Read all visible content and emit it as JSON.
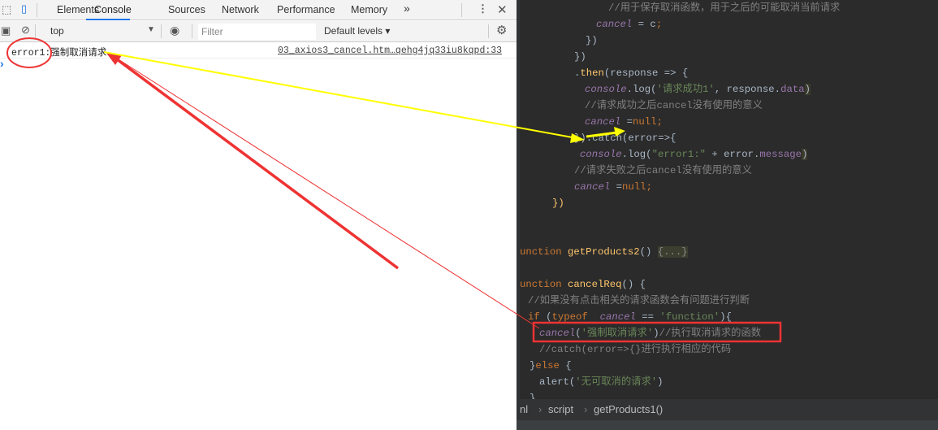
{
  "devtools": {
    "tabs": [
      "Elements",
      "Console",
      "Sources",
      "Network",
      "Performance",
      "Memory"
    ],
    "active_tab": "Console",
    "more_tabs": "»",
    "context": "top",
    "filter_placeholder": "Filter",
    "levels": "Default levels ▾",
    "console_message": {
      "text": "error1:强制取消请求",
      "source": "03_axios3_cancel.htm…qehg4jq33iu8kqpd:33"
    },
    "prompt": "›"
  },
  "editor": {
    "lines": [
      [
        [
          "//用于保存取消函数，用于之后的可能取消当前请求",
          "cm"
        ]
      ],
      [
        [
          "cancel",
          "it"
        ],
        [
          " = c",
          ""
        ],
        [
          ";",
          "kw"
        ]
      ],
      [
        [
          "})",
          ""
        ]
      ],
      [
        [
          "})",
          ""
        ]
      ],
      [
        [
          ".",
          ""
        ],
        [
          "then",
          "fn"
        ],
        [
          "(response => {",
          ""
        ]
      ],
      [
        [
          "console",
          "it"
        ],
        [
          ".log(",
          ""
        ],
        [
          "'请求成功1'",
          "str"
        ],
        [
          ", response.",
          ""
        ],
        [
          "data",
          "pr"
        ],
        [
          ")",
          "hl"
        ]
      ],
      [
        [
          "//请求成功之后cancel没有使用的意义",
          "cm"
        ]
      ],
      [
        [
          "cancel",
          "it"
        ],
        [
          " =",
          ""
        ],
        [
          "null;",
          "kw"
        ]
      ],
      [
        [
          "}).catch(error=>{",
          ""
        ]
      ],
      [
        [
          "console",
          "it"
        ],
        [
          ".log(",
          ""
        ],
        [
          "\"error1:\"",
          "str"
        ],
        [
          " + error.",
          ""
        ],
        [
          "message",
          "pr"
        ],
        [
          ")",
          "hl"
        ]
      ],
      [
        [
          "//请求失败之后cancel没有使用的意义",
          "cm"
        ]
      ],
      [
        [
          "cancel",
          "it"
        ],
        [
          " =",
          ""
        ],
        [
          "null;",
          "kw"
        ]
      ],
      [
        [
          "})",
          "fn"
        ]
      ],
      [
        [
          "unction ",
          "kw"
        ],
        [
          "getProducts2",
          "fn"
        ],
        [
          "() ",
          ""
        ],
        [
          "{...}",
          "fold"
        ]
      ],
      [
        [
          "unction ",
          "kw"
        ],
        [
          "cancelReq",
          "fn"
        ],
        [
          "() {",
          ""
        ]
      ],
      [
        [
          "//如果没有点击相关的请求函数会有问题进行判断",
          "cm"
        ]
      ],
      [
        [
          "if ",
          "kw"
        ],
        [
          "(",
          ""
        ],
        [
          "typeof  ",
          "kw"
        ],
        [
          "cancel",
          "it"
        ],
        [
          " == ",
          ""
        ],
        [
          "'function'",
          "str"
        ],
        [
          "){",
          ""
        ]
      ],
      [
        [
          "cancel",
          "it"
        ],
        [
          "(",
          ""
        ],
        [
          "'强制取消请求'",
          "str"
        ],
        [
          ")",
          ""
        ],
        [
          "//执行取消请求的函数",
          "cm"
        ]
      ],
      [
        [
          "//catch(error=>{}进行执行相应的代码",
          "cm"
        ]
      ],
      [
        [
          "}",
          ""
        ],
        [
          "else ",
          "kw"
        ],
        [
          "{",
          ""
        ]
      ],
      [
        [
          "alert(",
          ""
        ],
        [
          "'无可取消的请求'",
          "str"
        ],
        [
          ")",
          ""
        ]
      ],
      [
        [
          "}",
          ""
        ]
      ]
    ],
    "breadcrumb": [
      "nl",
      "script",
      "getProducts1()"
    ]
  },
  "annotations": {
    "arrow_color_yellow": "#ffff00",
    "arrow_color_red": "#ee3333"
  }
}
